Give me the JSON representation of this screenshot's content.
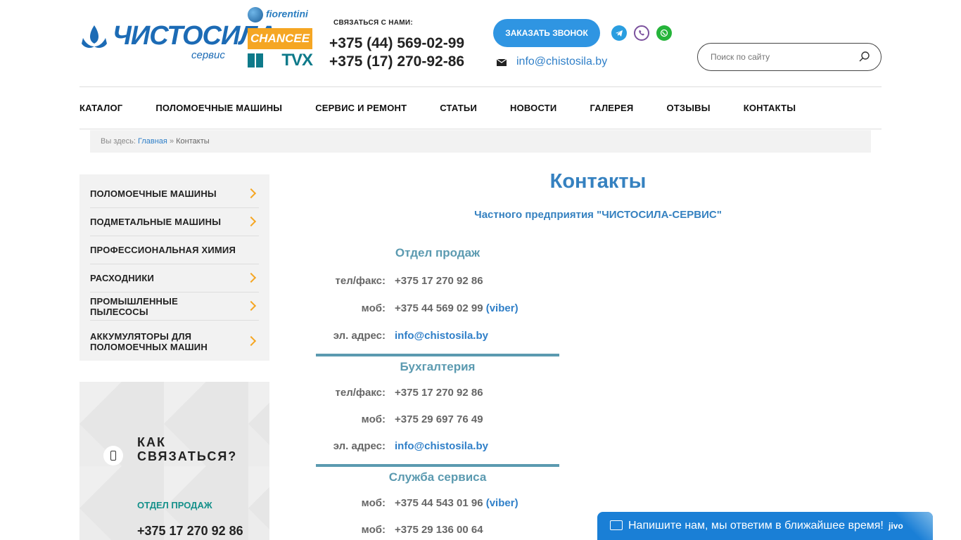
{
  "header": {
    "logo_text": "ЧИСТОСИЛА",
    "logo_sub": "сервис",
    "brands": {
      "fiorentini": "fiorentini",
      "chancee": "CHANCEE",
      "tvx": "TVX"
    },
    "contact_label": "СВЯЗАТЬСЯ С НАМИ:",
    "phone1": "+375 (44) 569-02-99",
    "phone2": "+375 (17) 270-92-86",
    "callback_label": "ЗАКАЗАТЬ ЗВОНОК",
    "email": "info@chistosila.by",
    "search_placeholder": "Поиск по сайту",
    "icons": {
      "telegram": "telegram-icon",
      "viber": "viber-icon",
      "whatsapp": "whatsapp-icon",
      "mail": "envelope-icon",
      "search": "search-icon"
    }
  },
  "nav": {
    "items": [
      {
        "label": "КАТАЛОГ"
      },
      {
        "label": "ПОЛОМОЕЧНЫЕ МАШИНЫ"
      },
      {
        "label": "СЕРВИС И РЕМОНТ"
      },
      {
        "label": "СТАТЬИ"
      },
      {
        "label": "НОВОСТИ"
      },
      {
        "label": "ГАЛЕРЕЯ"
      },
      {
        "label": "ОТЗЫВЫ"
      },
      {
        "label": "КОНТАКТЫ"
      }
    ]
  },
  "breadcrumb": {
    "prefix": "Вы здесь:",
    "home": "Главная",
    "sep": "»",
    "current": "Контакты"
  },
  "sidebar": {
    "items": [
      {
        "label": "ПОЛОМОЕЧНЫЕ МАШИНЫ",
        "has_arrow": true
      },
      {
        "label": "ПОДМЕТАЛЬНЫЕ МАШИНЫ",
        "has_arrow": true
      },
      {
        "label": "ПРОФЕССИОНАЛЬНАЯ ХИМИЯ",
        "has_arrow": false
      },
      {
        "label": "РАСХОДНИКИ",
        "has_arrow": true
      },
      {
        "label": "ПРОМЫШЛЕННЫЕ ПЫЛЕСОСЫ",
        "has_arrow": true
      },
      {
        "label": "АККУМУЛЯТОРЫ ДЛЯ ПОЛОМОЕЧНЫХ МАШИН",
        "has_arrow": true
      }
    ],
    "how": {
      "title": "КАК\nСВЯЗАТЬСЯ?",
      "dept": "ОТДЕЛ ПРОДАЖ",
      "phone": "+375 17 270 92 86"
    }
  },
  "main": {
    "title": "Контакты",
    "company": "Частного предприятия \"ЧИСТОСИЛА-СЕРВИС\"",
    "sales": {
      "title": "Отдел продаж",
      "tel_label": "тел/факс:",
      "tel": "+375 17 270 92 86",
      "mob_label": "моб:",
      "mob": "+375 44 569 02 99",
      "mob_note": "(viber)",
      "email_label": "эл. адрес:",
      "email": "info@chistosila.by"
    },
    "accounting": {
      "title": "Бухгалтерия",
      "tel_label": "тел/факс:",
      "tel": "+375 17 270 92 86",
      "mob_label": "моб:",
      "mob": "+375 29 697 76 49",
      "email_label": "эл. адрес:",
      "email": "info@chistosila.by"
    },
    "service": {
      "title": "Служба сервиса",
      "mob1_label": "моб:",
      "mob1": "+375 44 543 01 96",
      "mob1_note": "(viber)",
      "mob2_label": "моб:",
      "mob2": "+375 29 136 00 64"
    }
  },
  "chat": {
    "text": "Напишите нам, мы ответим в ближайшее время!",
    "brand": "jivo"
  },
  "colors": {
    "accent": "#2f95e2",
    "title": "#3581c0",
    "dept": "#5b9ab0",
    "arrow": "#f5a623"
  }
}
